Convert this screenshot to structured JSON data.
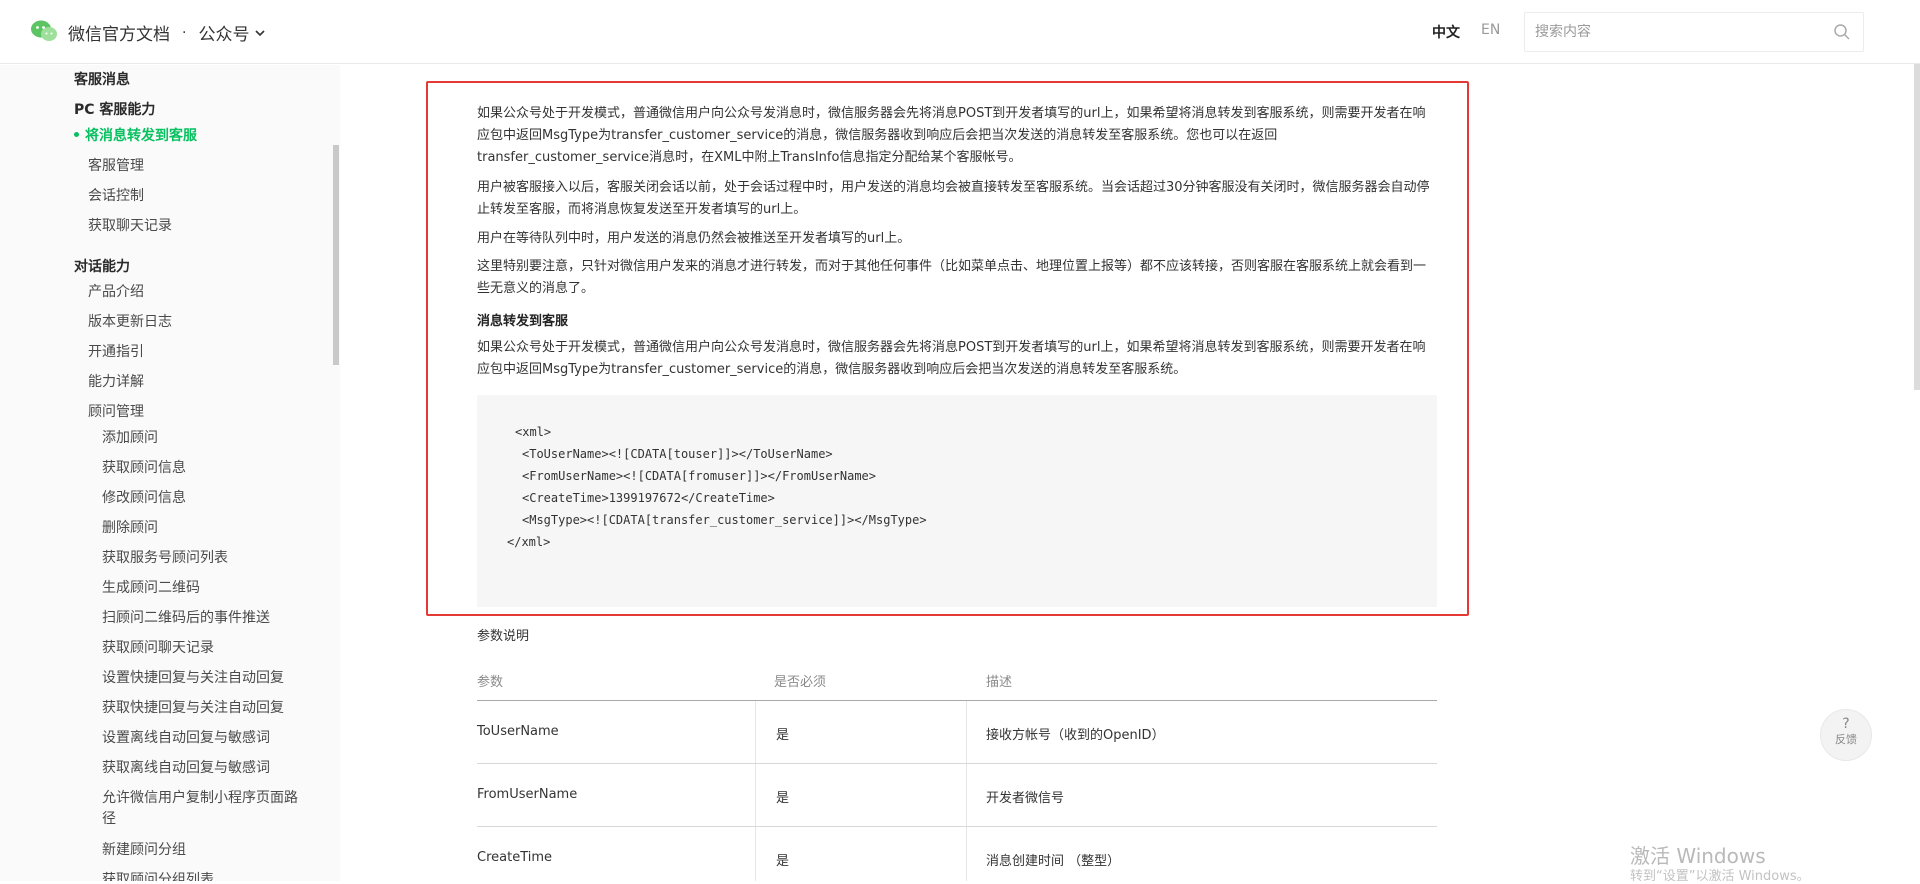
{
  "header": {
    "brand": "微信官方文档",
    "separator": "·",
    "product": "公众号",
    "lang_zh": "中文",
    "lang_en": "EN",
    "search_placeholder": "搜索内容"
  },
  "sidebar": {
    "items": [
      {
        "label": "客服消息",
        "kind": "heading"
      },
      {
        "label": "PC 客服能力",
        "kind": "heading"
      },
      {
        "label": "将消息转发到客服",
        "kind": "active"
      },
      {
        "label": "客服管理",
        "kind": "level1"
      },
      {
        "label": "会话控制",
        "kind": "level1"
      },
      {
        "label": "获取聊天记录",
        "kind": "level1"
      },
      {
        "label": "对话能力",
        "kind": "heading"
      },
      {
        "label": "产品介绍",
        "kind": "level1"
      },
      {
        "label": "版本更新日志",
        "kind": "level1"
      },
      {
        "label": "开通指引",
        "kind": "level1"
      },
      {
        "label": "能力详解",
        "kind": "level1"
      },
      {
        "label": "顾问管理",
        "kind": "level1"
      },
      {
        "label": "添加顾问",
        "kind": "level2"
      },
      {
        "label": "获取顾问信息",
        "kind": "level2"
      },
      {
        "label": "修改顾问信息",
        "kind": "level2"
      },
      {
        "label": "删除顾问",
        "kind": "level2"
      },
      {
        "label": "获取服务号顾问列表",
        "kind": "level2"
      },
      {
        "label": "生成顾问二维码",
        "kind": "level2"
      },
      {
        "label": "扫顾问二维码后的事件推送",
        "kind": "level2"
      },
      {
        "label": "获取顾问聊天记录",
        "kind": "level2"
      },
      {
        "label": "设置快捷回复与关注自动回复",
        "kind": "level2"
      },
      {
        "label": "获取快捷回复与关注自动回复",
        "kind": "level2"
      },
      {
        "label": "设置离线自动回复与敏感词",
        "kind": "level2"
      },
      {
        "label": "获取离线自动回复与敏感词",
        "kind": "level2"
      },
      {
        "label": "允许微信用户复制小程序页面路",
        "kind": "level2"
      },
      {
        "label": "径",
        "kind": "level2"
      },
      {
        "label": "新建顾问分组",
        "kind": "level2"
      },
      {
        "label": "获取顾问分组列表",
        "kind": "level2"
      }
    ]
  },
  "content": {
    "p1": "如果公众号处于开发模式，普通微信用户向公众号发消息时，微信服务器会先将消息POST到开发者填写的url上，如果希望将消息转发到客服系统，则需要开发者在响应包中返回MsgType为transfer_customer_service的消息，微信服务器收到响应后会把当次发送的消息转发至客服系统。您也可以在返回transfer_customer_service消息时，在XML中附上TransInfo信息指定分配给某个客服帐号。",
    "p2": "用户被客服接入以后，客服关闭会话以前，处于会话过程中时，用户发送的消息均会被直接转发至客服系统。当会话超过30分钟客服没有关闭时，微信服务器会自动停止转发至客服，而将消息恢复发送至开发者填写的url上。",
    "p3": "用户在等待队列中时，用户发送的消息仍然会被推送至开发者填写的url上。",
    "p4": "这里特别要注意，只针对微信用户发来的消息才进行转发，而对于其他任何事件（比如菜单点击、地理位置上报等）都不应该转接，否则客服在客服系统上就会看到一些无意义的消息了。",
    "subheading": "消息转发到客服",
    "p5": "如果公众号处于开发模式，普通微信用户向公众号发消息时，微信服务器会先将消息POST到开发者填写的url上，如果希望将消息转发到客服系统，则需要开发者在响应包中返回MsgType为transfer_customer_service的消息，微信服务器收到响应后会把当次发送的消息转发至客服系统。",
    "code": [
      "<xml>",
      "<ToUserName><![CDATA[touser]]></ToUserName>",
      "<FromUserName><![CDATA[fromuser]]></FromUserName>",
      "<CreateTime>1399197672</CreateTime>",
      "<MsgType><![CDATA[transfer_customer_service]]></MsgType>",
      "</xml>"
    ],
    "param_title": "参数说明",
    "table": {
      "headers": [
        "参数",
        "是否必须",
        "描述"
      ],
      "rows": [
        [
          "ToUserName",
          "是",
          "接收方帐号（收到的OpenID）"
        ],
        [
          "FromUserName",
          "是",
          "开发者微信号"
        ],
        [
          "CreateTime",
          "是",
          "消息创建时间 （整型）"
        ]
      ]
    }
  },
  "feedback": {
    "icon": "?",
    "label": "反馈"
  },
  "watermark": {
    "line1": "激活 Windows",
    "line2": "转到“设置”以激活 Windows。"
  },
  "colors": {
    "accent": "#07c160",
    "highlight_border": "#e53935"
  }
}
